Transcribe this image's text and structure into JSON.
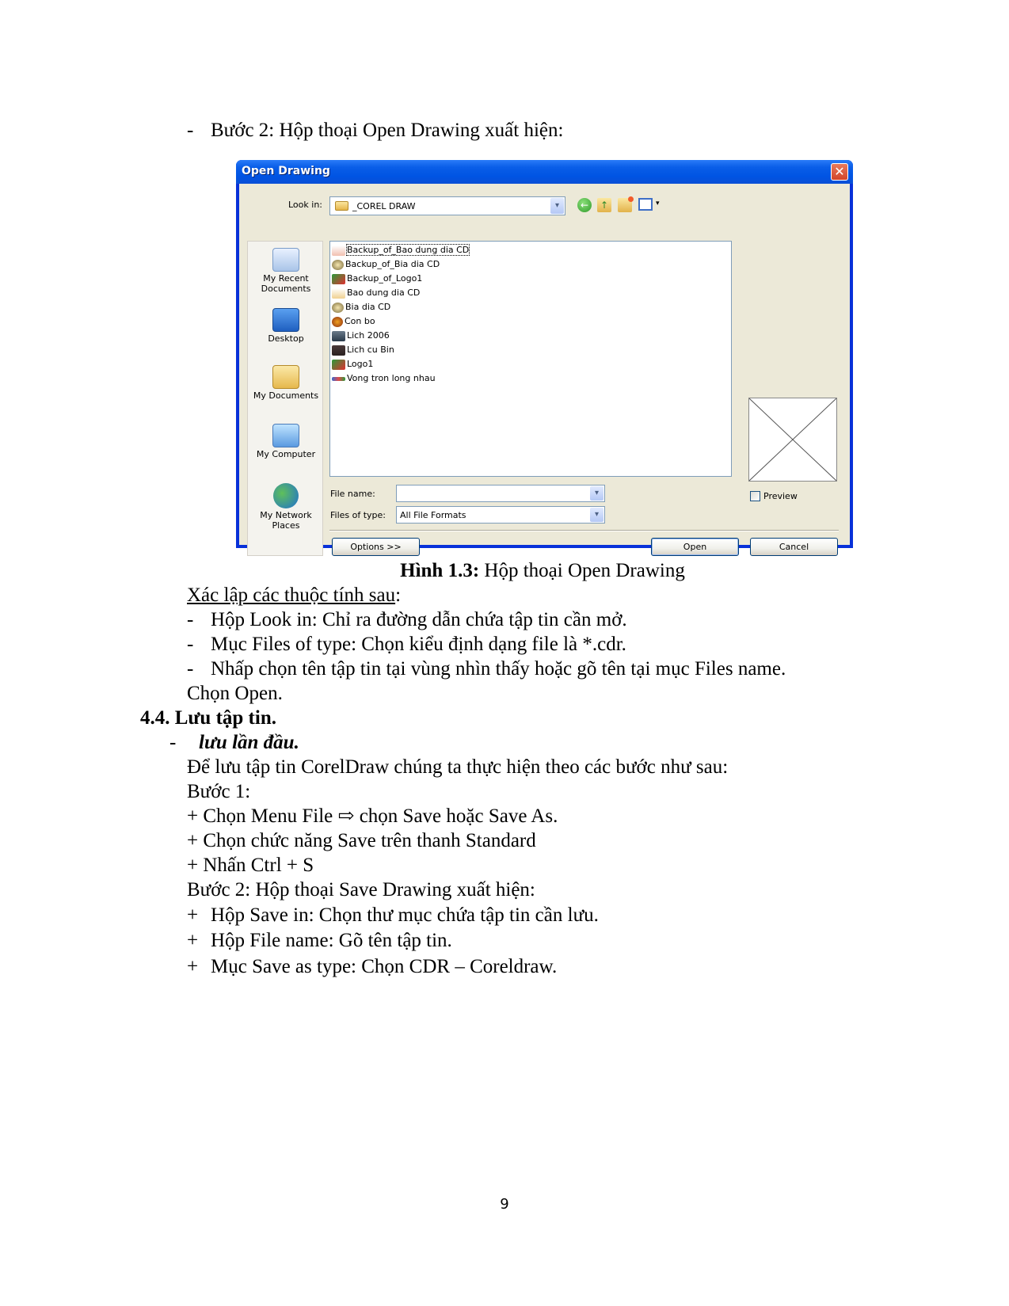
{
  "intro": {
    "dash": "-",
    "text": "Bước 2: Hộp thoại Open Drawing xuất hiện:"
  },
  "dialog": {
    "title": "Open Drawing",
    "close_icon": "close-icon",
    "look_in_label": "Look in:",
    "look_in_value": "_COREL DRAW",
    "toolbar_icons": [
      "back-icon",
      "up-folder-icon",
      "new-folder-icon",
      "view-menu-icon"
    ],
    "places": [
      {
        "label": "My Recent Documents",
        "icon": "recent-documents-icon"
      },
      {
        "label": "Desktop",
        "icon": "desktop-icon"
      },
      {
        "label": "My Documents",
        "icon": "my-documents-icon"
      },
      {
        "label": "My Computer",
        "icon": "my-computer-icon"
      },
      {
        "label": "My Network Places",
        "icon": "network-places-icon"
      }
    ],
    "files": [
      "Backup_of_Bao dung dia CD",
      "Backup_of_Bia dia CD",
      "Backup_of_Logo1",
      "Bao dung dia CD",
      "Bia dia CD",
      "Con bo",
      "Lich 2006",
      "Lich cu Bin",
      "Logo1",
      "Vong tron long nhau"
    ],
    "selected_file": "Backup_of_Bao dung dia CD",
    "file_name_label": "File name:",
    "file_name_value": "",
    "files_of_type_label": "Files of type:",
    "files_of_type_value": "All File Formats",
    "preview_label": "Preview",
    "preview_checked": false,
    "options_button": "Options >>",
    "open_button": "Open",
    "cancel_button": "Cancel",
    "colors": {
      "title_bar": "#0054e3",
      "body": "#ece9d8",
      "close": "#d2452a"
    }
  },
  "caption": {
    "bold": "Hình 1.3:",
    "text": " Hộp thoại Open Drawing"
  },
  "content": {
    "setup_heading": "Xác lập các thuộc tính sau",
    "setup_colon": ":",
    "bullets": [
      "Hộp Look in: Chỉ ra đường dẫn chứa tập tin cần mở.",
      "Mục Files of type: Chọn kiểu định dạng file là *.cdr.",
      "Nhấp chọn tên tập tin tại vùng nhìn thấy hoặc gõ tên tại mục Files name."
    ],
    "choose_open": "Chọn Open.",
    "section_heading": "4.4. Lưu tập tin.",
    "subheading": "lưu lần đầu.",
    "intro_save": "Để lưu tập tin CorelDraw chúng ta thực hiện theo các bước như sau:",
    "step1": "Bước 1:",
    "step1_items": [
      "+ Chọn Menu File ⇨ chọn Save hoặc Save As.",
      "+ Chọn chức năng Save trên thanh Standard",
      "+ Nhấn Ctrl + S"
    ],
    "step2": "Bước 2: Hộp thoại Save Drawing xuất hiện:",
    "step2_items": [
      "Hộp Save in: Chọn thư mục chứa tập tin cần lưu.",
      "Hộp File name: Gõ tên tập tin.",
      "Mục Save as type: Chọn CDR – Coreldraw."
    ]
  },
  "page_number": "9"
}
